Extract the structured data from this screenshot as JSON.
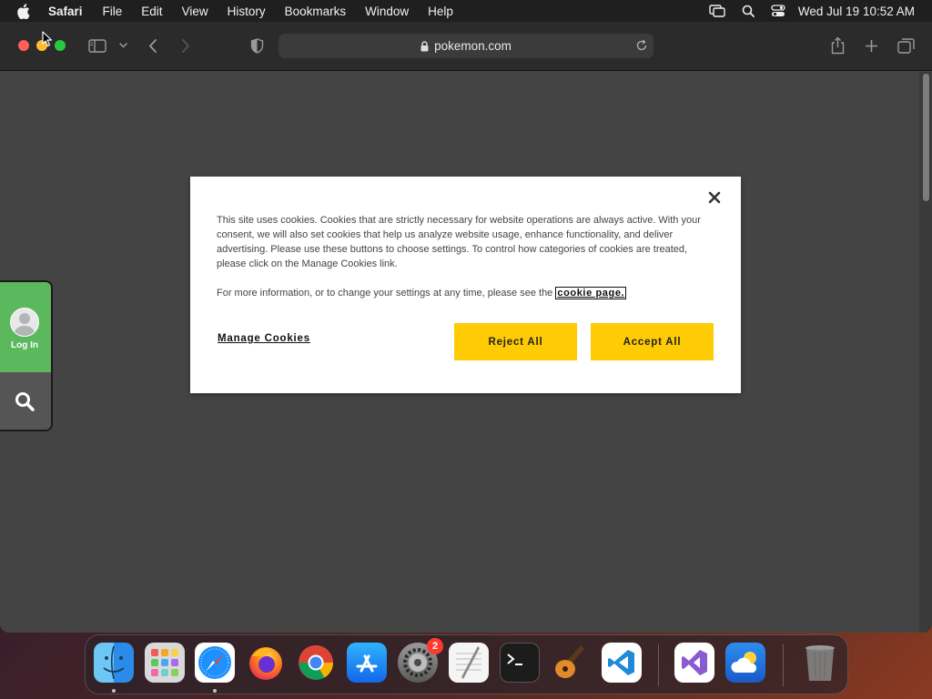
{
  "menubar": {
    "app_name": "Safari",
    "items": [
      "File",
      "Edit",
      "View",
      "History",
      "Bookmarks",
      "Window",
      "Help"
    ],
    "clock": "Wed Jul 19  10:52 AM"
  },
  "browser": {
    "url": "pokemon.com"
  },
  "side_widget": {
    "login_label": "Log In"
  },
  "cookie_dialog": {
    "body": "This site uses cookies. Cookies that are strictly necessary for website operations are always active. With your consent, we will also set cookies that help us analyze website usage, enhance functionality, and deliver advertising. Please use these buttons to choose settings. To control how categories of cookies are treated, please click on the Manage Cookies link.",
    "more_info": "For more information, or to change your settings at any time, please see the ",
    "link_text": "cookie page.",
    "manage_label": "Manage Cookies",
    "reject_label": "Reject All",
    "accept_label": "Accept All",
    "button_color": "#ffcb05"
  },
  "dock": {
    "apps": [
      "finder",
      "launchpad",
      "safari",
      "firefox",
      "chrome",
      "app-store",
      "system-settings",
      "textedit",
      "terminal",
      "garageband",
      "vscode",
      "visual-studio",
      "weather",
      "trash"
    ],
    "settings_badge": "2"
  }
}
